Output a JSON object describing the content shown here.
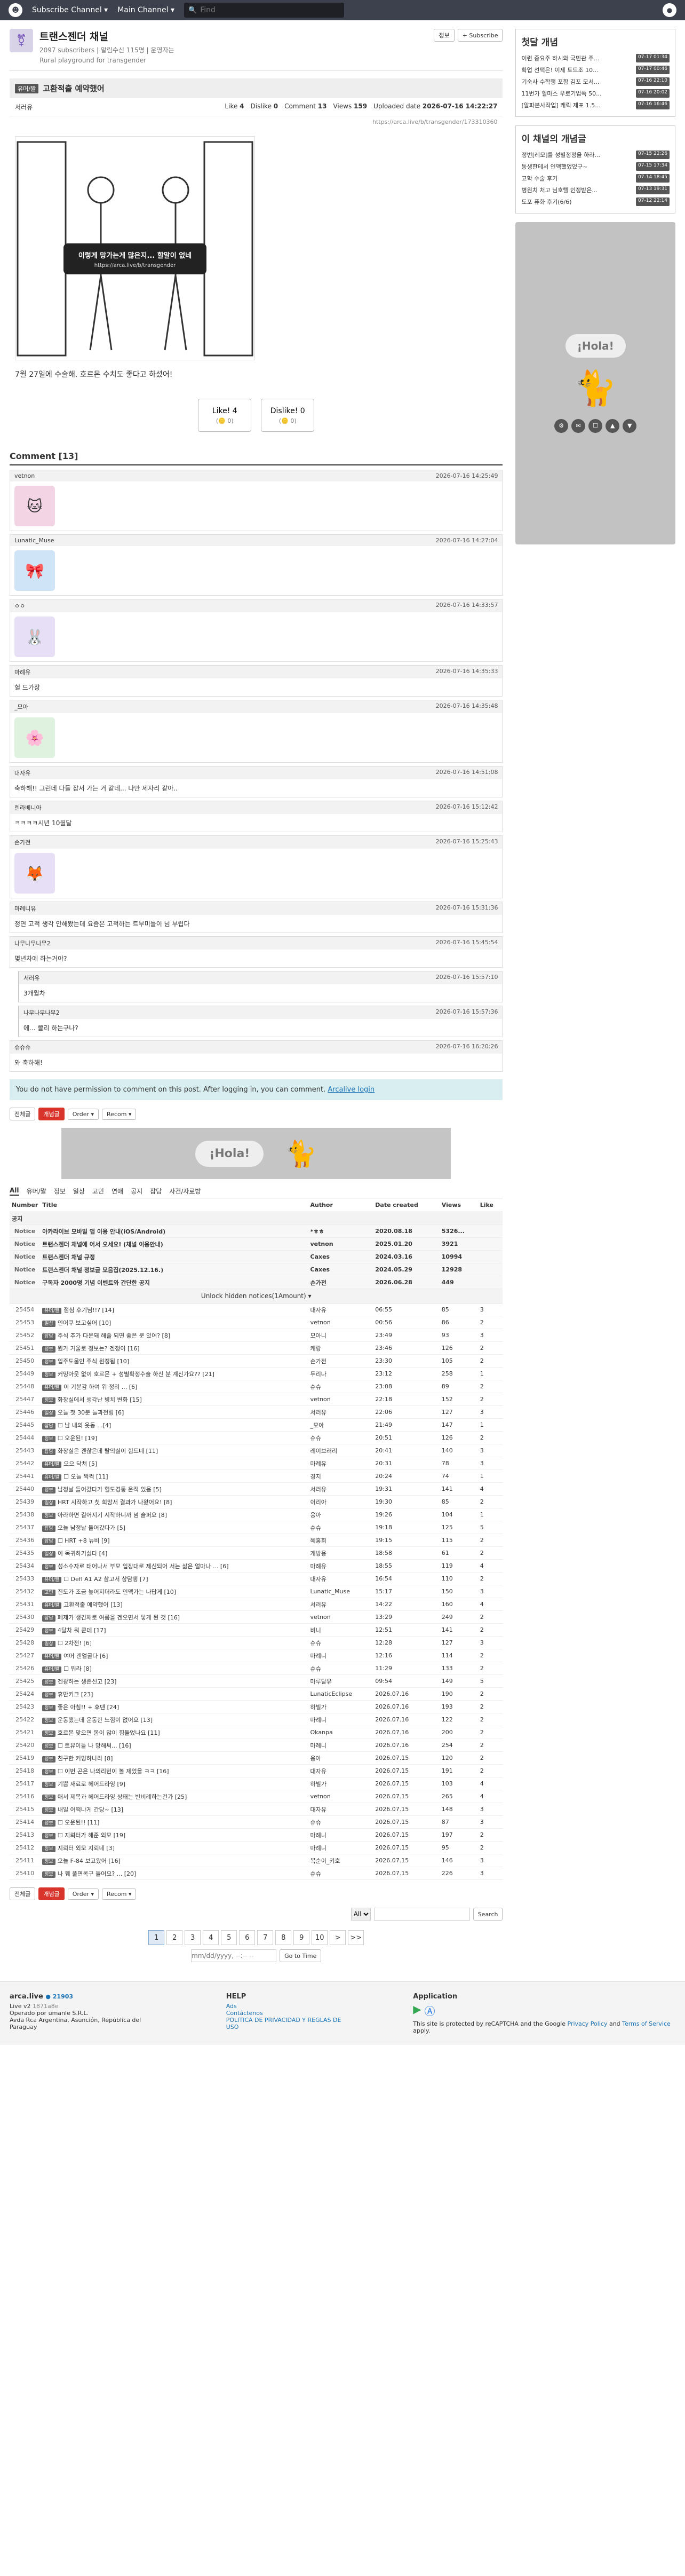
{
  "top": {
    "subscribe": "Subscribe Channel ▾",
    "main": "Main Channel ▾",
    "search_placeholder": "Find"
  },
  "channel": {
    "name": "트랜스젠더 채널",
    "stats": "2097 subscribers | 알림수신 115명 | 운영자는",
    "desc": "Rural playground for transgender",
    "btn_info": "정보",
    "btn_subscribe": "+ Subscribe"
  },
  "post": {
    "badge": "유머/짤",
    "title": "고환적출 예약했어",
    "author": "서러유",
    "like_label": "Like",
    "like": "4",
    "dislike_label": "Dislike",
    "dislike": "0",
    "comment_label": "Comment",
    "comment": "13",
    "views_label": "Views",
    "views": "159",
    "upload_label": "Uploaded date",
    "date": "2026-07-16 14:22:27",
    "url": "https://arca.live/b/transgender/173310360",
    "img_caption": "이렇게 망가는게 많은지... 할말이 없네",
    "img_url": "https://arca.live/b/transgender",
    "text": "7월 27일에 수술해. 호르몬 수치도 좋다고 하셨어!",
    "like_btn": "Like!",
    "like_count": "4",
    "dislike_btn": "Dislike!",
    "dislike_count": "0",
    "like_sub": "(🪙 0)",
    "dislike_sub": "(🪙 0)"
  },
  "comments": {
    "title": "Comment [13]",
    "items": [
      {
        "user": "vetnon",
        "time": "2026-07-16 14:25:49",
        "text": "",
        "sticker": "🐱"
      },
      {
        "user": "Lunatic_Muse",
        "time": "2026-07-16 14:27:04",
        "text": "",
        "sticker": "🎀"
      },
      {
        "user": "ㅇㅇ",
        "time": "2026-07-16 14:33:57",
        "text": "",
        "sticker": "🐰"
      },
      {
        "user": "마례유",
        "time": "2026-07-16 14:35:33",
        "text": "헐 드가장",
        "sticker": ""
      },
      {
        "user": "_모아",
        "time": "2026-07-16 14:35:48",
        "text": "",
        "sticker": "🌸"
      },
      {
        "user": "대자유",
        "time": "2026-07-16 14:51:08",
        "text": "축하해!! 그런데 다들 잡서 가는 거 같네... 나만 제자리 같아..",
        "sticker": ""
      },
      {
        "user": "렌라베니아",
        "time": "2026-07-16 15:12:42",
        "text": "ㅋㅋㅋㅋ시년 10월달",
        "sticker": ""
      },
      {
        "user": "손가전",
        "time": "2026-07-16 15:25:43",
        "text": "",
        "sticker": "🦊"
      },
      {
        "user": "마례니유",
        "time": "2026-07-16 15:31:36",
        "text": "정면 고적 생각 안해봤는데 요즘은 고적하는 트부미들이 넘 부럽다",
        "sticker": ""
      },
      {
        "user": "나무나무나무2",
        "time": "2026-07-16 15:45:54",
        "text": "몇년차에 하는거야?",
        "sticker": ""
      }
    ],
    "replies": [
      {
        "user": "서러유",
        "time": "2026-07-16 15:57:10",
        "text": "3개월차"
      },
      {
        "user": "나무나무나무2",
        "time": "2026-07-16 15:57:36",
        "text": "에... 빨리 하는구나?"
      }
    ],
    "last": {
      "user": "슈슈슈",
      "time": "2026-07-16 16:20:26",
      "text": "와 축하해!"
    }
  },
  "login_notice": "You do not have permission to comment on this post. After logging in, you can comment.",
  "login_link": "Arcalive login",
  "toolbar": {
    "all": "전체글",
    "hot": "개념글",
    "order": "Order ▾",
    "recom": "Recom ▾"
  },
  "ad_text": "¡Hola!",
  "cats": [
    "All",
    "유머/짤",
    "정보",
    "일상",
    "고민",
    "연애",
    "공지",
    "잡담",
    "사건/자료방"
  ],
  "headers": {
    "number": "Number",
    "title": "Title",
    "author": "Author",
    "date": "Date created",
    "views": "Views",
    "like": "Like"
  },
  "notice_label": "공지",
  "notices": [
    {
      "n": "Notice",
      "t": "아카라이브 모바일 앱 이용 안내(iOS/Android)",
      "a": "*ㅎㅎ",
      "d": "2020.08.18",
      "v": "5326...",
      "l": ""
    },
    {
      "n": "Notice",
      "t": "트랜스젠더 채널에 어서 오세요! (채널 이용안내)",
      "a": "vetnon",
      "d": "2025.01.20",
      "v": "3921",
      "l": ""
    },
    {
      "n": "Notice",
      "t": "트랜스젠더 채널 규정",
      "a": "Caxes",
      "d": "2024.03.16",
      "v": "10994",
      "l": ""
    },
    {
      "n": "Notice",
      "t": "트랜스젠더 채널 정보글 모음집(2025.12.16.)",
      "a": "Caxes",
      "d": "2024.05.29",
      "v": "12928",
      "l": ""
    },
    {
      "n": "Notice",
      "t": "구독자 2000명 기념 이벤트와 간단한 공지",
      "a": "손가전",
      "d": "2026.06.28",
      "v": "449",
      "l": ""
    }
  ],
  "unlock": "Unlock hidden notices(1Amount) ▾",
  "rows": [
    {
      "n": "25454",
      "b": "유머/짤",
      "t": "점심 후기님!!? [14]",
      "a": "대자유",
      "d": "06:55",
      "v": "85",
      "l": "3"
    },
    {
      "n": "25453",
      "b": "일상",
      "t": "인어쿠 보고싶어 [10]",
      "a": "vetnon",
      "d": "00:56",
      "v": "86",
      "l": "2"
    },
    {
      "n": "25452",
      "b": "잡담",
      "t": "주식 추가 다운돼 해줄 되면 좋은 분 있어? [8]",
      "a": "모아니",
      "d": "23:49",
      "v": "93",
      "l": "3"
    },
    {
      "n": "25451",
      "b": "정보",
      "t": "뭔가 거울로 정보는? 겐정이 [16]",
      "a": "캐랑",
      "d": "23:46",
      "v": "126",
      "l": "2"
    },
    {
      "n": "25450",
      "b": "정보",
      "t": "입주도움인 주식 원정됨 [10]",
      "a": "손가전",
      "d": "23:30",
      "v": "105",
      "l": "2"
    },
    {
      "n": "25449",
      "b": "정보",
      "t": "커밍아웃 없이 호르몬 + 성별확정수술 하신 분 계신가요?? [21]",
      "a": "두리나",
      "d": "23:12",
      "v": "258",
      "l": "1"
    },
    {
      "n": "25448",
      "b": "유머/짤",
      "t": "이 기분감 하여 위 정리 ... [6]",
      "a": "슈슈",
      "d": "23:08",
      "v": "89",
      "l": "2"
    },
    {
      "n": "25447",
      "b": "정보",
      "t": "화장실에서 생각난 병치 변화 [15]",
      "a": "vetnon",
      "d": "22:18",
      "v": "152",
      "l": "2"
    },
    {
      "n": "25446",
      "b": "일상",
      "t": "오늘 첫 30분 늘과전링 [6]",
      "a": "서러유",
      "d": "22:06",
      "v": "127",
      "l": "3"
    },
    {
      "n": "25445",
      "b": "잡담",
      "t": "☐ 남 내의 옷동 ...[4]",
      "a": "_모아",
      "d": "21:49",
      "v": "147",
      "l": "1"
    },
    {
      "n": "25444",
      "b": "정보",
      "t": "☐ 오운된! [19]",
      "a": "슈슈",
      "d": "20:51",
      "v": "126",
      "l": "2"
    },
    {
      "n": "25443",
      "b": "잡담",
      "t": "화장실은 괜찮은데 탈의실이 힘드네 [11]",
      "a": "레이브러리",
      "d": "20:41",
      "v": "140",
      "l": "3"
    },
    {
      "n": "25442",
      "b": "유머/짤",
      "t": "으으 닥쳐 [5]",
      "a": "마례유",
      "d": "20:31",
      "v": "78",
      "l": "3"
    },
    {
      "n": "25441",
      "b": "유머/짤",
      "t": "☐ 오늘 쩍쩍 [11]",
      "a": "경지",
      "d": "20:24",
      "v": "74",
      "l": "1"
    },
    {
      "n": "25440",
      "b": "정보",
      "t": "남정날 들어갔다가 혈도경통 온적 있음 [5]",
      "a": "서러유",
      "d": "19:31",
      "v": "141",
      "l": "4"
    },
    {
      "n": "25439",
      "b": "일상",
      "t": "HRT 시작하고 첫 희망서 결과가 나왔어요! [8]",
      "a": "이리아",
      "d": "19:30",
      "v": "85",
      "l": "2"
    },
    {
      "n": "25438",
      "b": "정보",
      "t": "아라하면 길어지기 시작하니까 넘 슬퍼요 [8]",
      "a": "응아",
      "d": "19:26",
      "v": "104",
      "l": "1"
    },
    {
      "n": "25437",
      "b": "잡담",
      "t": "오늘 남정날 들어갔다가 [5]",
      "a": "슈슈",
      "d": "19:18",
      "v": "125",
      "l": "5"
    },
    {
      "n": "25436",
      "b": "잡담",
      "t": "☐ HRT +8 뉴비 [9]",
      "a": "혜홍희",
      "d": "19:15",
      "v": "115",
      "l": "2"
    },
    {
      "n": "25435",
      "b": "일상",
      "t": "이 목귀하기싫다 [4]",
      "a": "개방용",
      "d": "18:58",
      "v": "61",
      "l": "2"
    },
    {
      "n": "25434",
      "b": "정보",
      "t": "성소수자로 태어나서 부모 입장대로 제신되어 서는 삶은 얼마나 ... [6]",
      "a": "마례유",
      "d": "18:55",
      "v": "119",
      "l": "4"
    },
    {
      "n": "25433",
      "b": "유머/짤",
      "t": "☐ Defl A1 A2 참고서 상담행 [7]",
      "a": "대자유",
      "d": "16:54",
      "v": "110",
      "l": "2"
    },
    {
      "n": "25432",
      "b": "고민",
      "t": "진도가 조금 높어지더라도 인맥가는 나답게 [10]",
      "a": "Lunatic_Muse",
      "d": "15:17",
      "v": "150",
      "l": "3"
    },
    {
      "n": "25431",
      "b": "유머/짤",
      "t": "고환적출 예약했어 [13]",
      "a": "서러유",
      "d": "14:22",
      "v": "160",
      "l": "4"
    },
    {
      "n": "25430",
      "b": "잡담",
      "t": "페제가 생긴채로 여름을 겐오면서 닿게 된 것 [16]",
      "a": "vetnon",
      "d": "13:29",
      "v": "249",
      "l": "2"
    },
    {
      "n": "25429",
      "b": "정보",
      "t": "4달차 뭐 쿤데 [17]",
      "a": "비니",
      "d": "12:51",
      "v": "141",
      "l": "2"
    },
    {
      "n": "25428",
      "b": "일상",
      "t": "☐ 2차전! [6]",
      "a": "슈슈",
      "d": "12:28",
      "v": "127",
      "l": "3"
    },
    {
      "n": "25427",
      "b": "유머/짤",
      "t": "여머 겐얼굴다 [6]",
      "a": "마례니",
      "d": "12:16",
      "v": "114",
      "l": "2"
    },
    {
      "n": "25426",
      "b": "유머/짤",
      "t": "☐ 뭐라 [8]",
      "a": "슈슈",
      "d": "11:29",
      "v": "133",
      "l": "2"
    },
    {
      "n": "25425",
      "b": "정보",
      "t": "겐광하는 생존신고 [23]",
      "a": "마루달유",
      "d": "09:54",
      "v": "149",
      "l": "5"
    },
    {
      "n": "25424",
      "b": "정보",
      "t": "휴만키크 [23]",
      "a": "LunaticEclipse",
      "d": "2026.07.16",
      "v": "190",
      "l": "2"
    },
    {
      "n": "25423",
      "b": "정보",
      "t": "좋은 아침!! + 후댄 [24]",
      "a": "하빌가",
      "d": "2026.07.16",
      "v": "193",
      "l": "2"
    },
    {
      "n": "25422",
      "b": "정보",
      "t": "운동했는데 운동한 느낌이 없어요 [13]",
      "a": "마례니",
      "d": "2026.07.16",
      "v": "122",
      "l": "2"
    },
    {
      "n": "25421",
      "b": "정보",
      "t": "호르몬 맞으면 몸이 많이 힘들었나요 [11]",
      "a": "Okanpa",
      "d": "2026.07.16",
      "v": "200",
      "l": "2"
    },
    {
      "n": "25420",
      "b": "정보",
      "t": "☐ 트뷰이들 나 망해써... [16]",
      "a": "마례니",
      "d": "2026.07.16",
      "v": "254",
      "l": "2"
    },
    {
      "n": "25419",
      "b": "정보",
      "t": "친구한 커밍하나라 [8]",
      "a": "응아",
      "d": "2026.07.15",
      "v": "120",
      "l": "2"
    },
    {
      "n": "25418",
      "b": "정보",
      "t": "☐ 이번 곤은 나의리턴이 볼 제었을 ㅋㅋ [16]",
      "a": "대자유",
      "d": "2026.07.15",
      "v": "191",
      "l": "2"
    },
    {
      "n": "25417",
      "b": "정보",
      "t": "기쁨 재료로 헤어드라잉 [9]",
      "a": "하빌가",
      "d": "2026.07.15",
      "v": "103",
      "l": "4"
    },
    {
      "n": "25416",
      "b": "정보",
      "t": "애서 제목과 헤어드라잉 상태는 반비례하는건가 [25]",
      "a": "vetnon",
      "d": "2026.07.15",
      "v": "265",
      "l": "4"
    },
    {
      "n": "25415",
      "b": "정보",
      "t": "내일 어떡냐게 간당~ [13]",
      "a": "대자유",
      "d": "2026.07.15",
      "v": "148",
      "l": "3"
    },
    {
      "n": "25414",
      "b": "정보",
      "t": "☐ 오운된!! [11]",
      "a": "슈슈",
      "d": "2026.07.15",
      "v": "87",
      "l": "3"
    },
    {
      "n": "25413",
      "b": "정보",
      "t": "☐ 지뢰터가 해준 외모 [19]",
      "a": "마례니",
      "d": "2026.07.15",
      "v": "197",
      "l": "2"
    },
    {
      "n": "25412",
      "b": "정보",
      "t": "지뢰터 외모 지뢰네 [3]",
      "a": "마례니",
      "d": "2026.07.15",
      "v": "95",
      "l": "2"
    },
    {
      "n": "25411",
      "b": "정보",
      "t": "오늘 F-84 보고왔어 [16]",
      "a": "복순이_키호",
      "d": "2026.07.15",
      "v": "146",
      "l": "3"
    },
    {
      "n": "25410",
      "b": "정보",
      "t": "나 퀘 풀면목구 들어요? ... [20]",
      "a": "슈슈",
      "d": "2026.07.15",
      "v": "226",
      "l": "3"
    }
  ],
  "pages": [
    "1",
    "2",
    "3",
    "4",
    "5",
    "6",
    "7",
    "8",
    "9",
    "10",
    ">",
    ">>"
  ],
  "search": {
    "select": "All",
    "placeholder": "",
    "btn": "Search"
  },
  "date_input": "mm/dd/yyyy, --:-- --",
  "goto": "Go to Time",
  "sidebar": {
    "hot_title": "첫달 개념",
    "hot": [
      {
        "t": "이런 중요주 하시와 국민관 주...",
        "time": "07-17 01:34"
      },
      {
        "t": "확업 선택은! 이제 토드조 10...",
        "time": "07-17 00:46"
      },
      {
        "t": "기숙사 수학행 포함 김포 모서...",
        "time": "07-16 22:10"
      },
      {
        "t": "11번가 혈마스 우로기업쪽 50...",
        "time": "07-16 20:02"
      },
      {
        "t": "[알파본사작업] 캐릭 제포 1.5...",
        "time": "07-16 16:46"
      }
    ],
    "ch_title": "이 채널의 개념글",
    "ch": [
      {
        "t": "정번[레모]를 성별정정을 하라...",
        "time": "07-15 22:26"
      },
      {
        "t": "동생한테서 인맥했었었구~",
        "time": "07-15 17:34"
      },
      {
        "t": "고학 수술 후기",
        "time": "07-14 18:45"
      },
      {
        "t": "병원치 처고 님호텔 인정받은...",
        "time": "07-13 19:31"
      },
      {
        "t": "도포 퓨화 후기(6/6)",
        "time": "07-12 22:14"
      }
    ]
  },
  "footer": {
    "brand": "arca.live",
    "users": "● 21903",
    "live": "Live v2",
    "ver": "1871a8e",
    "company": "Operado por umanle S.R.L.",
    "address": "Avda Rca Argentina, Asunción, República del Paraguay",
    "help": "HELP",
    "ads": "Ads",
    "contact": "Contáctenos",
    "policy": "POLITICA DE PRIVACIDAD Y REGLAS DE USO",
    "app": "Application",
    "recaptcha": "This site is protected by reCAPTCHA and the Google",
    "privacy": "Privacy Policy",
    "and": "and",
    "terms": "Terms of Service",
    "apply": "apply."
  }
}
